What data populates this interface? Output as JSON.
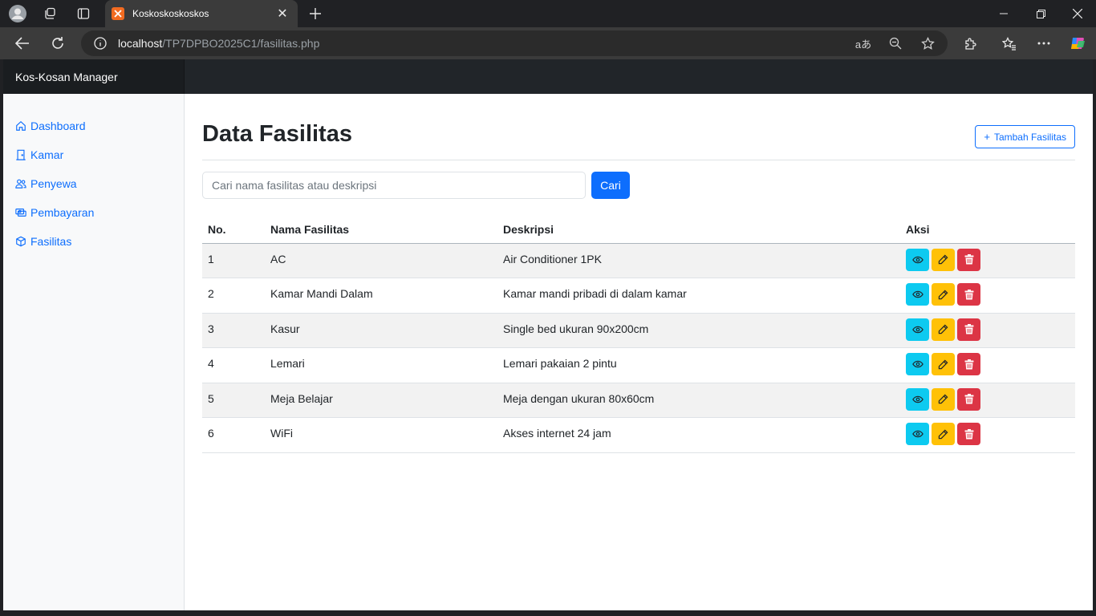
{
  "browser": {
    "tab_title": "Koskoskoskoskos",
    "url_host": "localhost",
    "url_path": "/TP7DPBO2025C1/fasilitas.php"
  },
  "app": {
    "brand": "Kos-Kosan Manager"
  },
  "sidebar": {
    "items": [
      {
        "label": "Dashboard",
        "icon": "home-icon"
      },
      {
        "label": "Kamar",
        "icon": "door-icon"
      },
      {
        "label": "Penyewa",
        "icon": "people-icon"
      },
      {
        "label": "Pembayaran",
        "icon": "cash-icon"
      },
      {
        "label": "Fasilitas",
        "icon": "box-icon"
      }
    ]
  },
  "main": {
    "title": "Data Fasilitas",
    "add_button": "Tambah Fasilitas",
    "search": {
      "placeholder": "Cari nama fasilitas atau deskripsi",
      "button": "Cari"
    },
    "table": {
      "headers": [
        "No.",
        "Nama Fasilitas",
        "Deskripsi",
        "Aksi"
      ],
      "rows": [
        {
          "no": "1",
          "nama": "AC",
          "deskripsi": "Air Conditioner 1PK"
        },
        {
          "no": "2",
          "nama": "Kamar Mandi Dalam",
          "deskripsi": "Kamar mandi pribadi di dalam kamar"
        },
        {
          "no": "3",
          "nama": "Kasur",
          "deskripsi": "Single bed ukuran 90x200cm"
        },
        {
          "no": "4",
          "nama": "Lemari",
          "deskripsi": "Lemari pakaian 2 pintu"
        },
        {
          "no": "5",
          "nama": "Meja Belajar",
          "deskripsi": "Meja dengan ukuran 80x60cm"
        },
        {
          "no": "6",
          "nama": "WiFi",
          "deskripsi": "Akses internet 24 jam"
        }
      ]
    }
  },
  "colors": {
    "primary": "#0d6efd",
    "info": "#0dcaf0",
    "warning": "#ffc107",
    "danger": "#dc3545",
    "navbar": "#212529"
  }
}
